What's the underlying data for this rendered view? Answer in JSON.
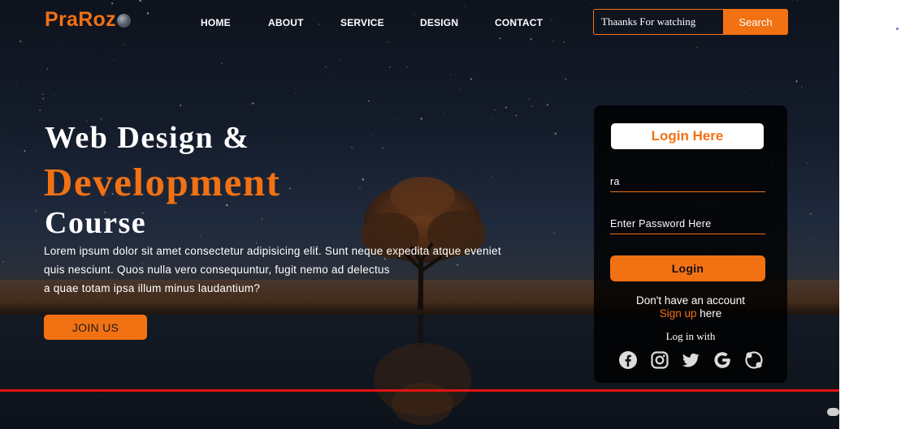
{
  "brand": {
    "logo_text": "PraRoz",
    "logo_icon": "globe-icon",
    "accent_color": "#f27113"
  },
  "nav": {
    "items": [
      {
        "label": "HOME"
      },
      {
        "label": "ABOUT"
      },
      {
        "label": "SERVICE"
      },
      {
        "label": "DESIGN"
      },
      {
        "label": "CONTACT"
      }
    ]
  },
  "search": {
    "value": "Thaanks For watching",
    "button_label": "Search"
  },
  "hero": {
    "title_line1": "Web Design &",
    "title_line2": "Development",
    "title_line3": "Course",
    "paragraph_lines": [
      "Lorem ipsum dolor sit amet consectetur adipisicing elit. Sunt neque expedita atque eveniet",
      "quis nesciunt. Quos nulla vero consequuntur, fugit nemo ad delectus",
      "a quae totam ipsa illum minus laudantium?"
    ],
    "join_label": "JOIN US"
  },
  "login": {
    "title": "Login Here",
    "username_value": "ra",
    "password_placeholder": "Enter Password Here",
    "button_label": "Login",
    "no_account_text": "Don't have an account",
    "signup_link": "Sign up",
    "signup_suffix": " here",
    "login_with_text": "Log in with",
    "social_icons": [
      "facebook-icon",
      "instagram-icon",
      "twitter-icon",
      "google-icon",
      "skype-icon"
    ]
  }
}
